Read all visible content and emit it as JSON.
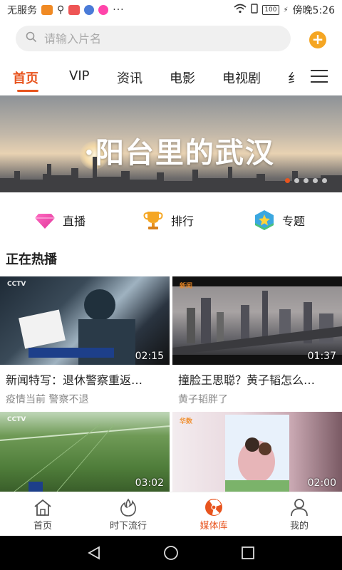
{
  "status_bar": {
    "left_text": "无服务",
    "dots": "···",
    "battery": "100",
    "time": "傍晚5:26"
  },
  "search": {
    "placeholder": "请输入片名",
    "add_label": "+"
  },
  "tabs": [
    {
      "label": "首页",
      "active": true
    },
    {
      "label": "VIP"
    },
    {
      "label": "资讯"
    },
    {
      "label": "电影"
    },
    {
      "label": "电视剧"
    },
    {
      "label": "纟"
    }
  ],
  "banner": {
    "title": "·阳台里的武汉",
    "dot_count": 5,
    "active_dot": 0
  },
  "quick_links": [
    {
      "label": "直播",
      "icon": "diamond-icon"
    },
    {
      "label": "排行",
      "icon": "trophy-icon"
    },
    {
      "label": "专题",
      "icon": "star-badge-icon"
    }
  ],
  "section": {
    "title": "正在热播"
  },
  "videos": [
    {
      "title": "新闻特写：退休警察重返…",
      "subtitle": "疫情当前 警察不退",
      "duration": "02:15"
    },
    {
      "title": "撞脸王思聪？黄子韬怎么…",
      "subtitle": "黄子韬胖了",
      "duration": "01:37"
    },
    {
      "title": "",
      "subtitle": "",
      "duration": "03:02"
    },
    {
      "title": "",
      "subtitle": "",
      "duration": "02:00"
    }
  ],
  "bottom_nav": [
    {
      "label": "首页",
      "icon": "home-icon"
    },
    {
      "label": "时下流行",
      "icon": "flame-icon"
    },
    {
      "label": "媒体库",
      "icon": "radiation-icon",
      "active": true
    },
    {
      "label": "我的",
      "icon": "user-icon"
    }
  ],
  "colors": {
    "accent": "#e8541e",
    "plus": "#f5a623"
  }
}
